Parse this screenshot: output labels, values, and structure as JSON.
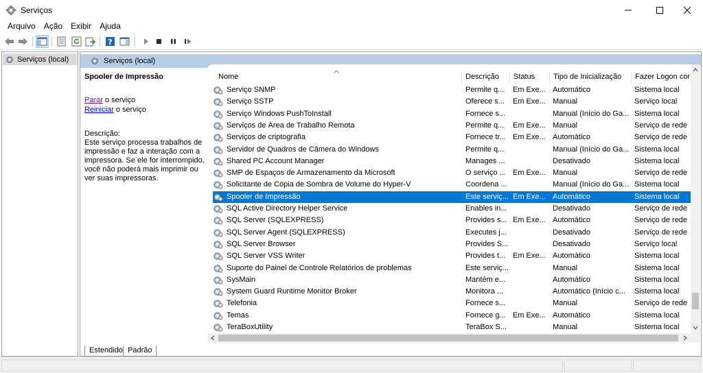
{
  "window": {
    "title": "Serviços"
  },
  "menu": [
    "Arquivo",
    "Ação",
    "Exibir",
    "Ajuda"
  ],
  "tree": {
    "root": "Serviços (local)"
  },
  "panel": {
    "header": "Serviços (local)"
  },
  "detail": {
    "service_name": "Spooler de Impressão",
    "stop_link": "Parar",
    "stop_suffix": " o serviço",
    "restart_link": "Reiniciar",
    "restart_suffix": " o serviço",
    "desc_label": "Descrição:",
    "description": "Este serviço processa trabalhos de impressão e faz a interação com a impressora. Se ele for interrompido, você não poderá mais imprimir ou ver suas impressoras."
  },
  "columns": {
    "name": "Nome",
    "description": "Descrição",
    "status": "Status",
    "startup": "Tipo de Inicialização",
    "logon": "Fazer Logon com"
  },
  "rows": [
    {
      "name": "Serviço SNMP",
      "desc": "Permite q...",
      "status": "Em Exe...",
      "startup": "Automático",
      "logon": "Sistema local"
    },
    {
      "name": "Serviço SSTP",
      "desc": "Oferece s...",
      "status": "Em Exe...",
      "startup": "Manual",
      "logon": "Serviço local"
    },
    {
      "name": "Serviço Windows PushToInstall",
      "desc": "Fornece s...",
      "status": "",
      "startup": "Manual (Início do Ga...",
      "logon": "Sistema local"
    },
    {
      "name": "Serviços de Área de Trabalho Remota",
      "desc": "Permite q...",
      "status": "Em Exe...",
      "startup": "Manual",
      "logon": "Serviço de rede"
    },
    {
      "name": "Serviços de criptografia",
      "desc": "Fornece tr...",
      "status": "Em Exe...",
      "startup": "Automático",
      "logon": "Serviço de rede"
    },
    {
      "name": "Servidor de Quadros de Câmera do Windows",
      "desc": "Permite q...",
      "status": "",
      "startup": "Manual (Início do Ga...",
      "logon": "Sistema local"
    },
    {
      "name": "Shared PC Account Manager",
      "desc": "Manages ...",
      "status": "",
      "startup": "Desativado",
      "logon": "Sistema local"
    },
    {
      "name": "SMP de Espaços de Armazenamento da Microsoft",
      "desc": "O serviço ...",
      "status": "Em Exe...",
      "startup": "Manual",
      "logon": "Serviço de rede"
    },
    {
      "name": "Solicitante de Cópia de Sombra de Volume do Hyper-V",
      "desc": "Coordena ...",
      "status": "",
      "startup": "Manual (Início do Ga...",
      "logon": "Sistema local"
    },
    {
      "name": "Spooler de Impressão",
      "desc": "Este serviç...",
      "status": "Em Exe...",
      "startup": "Automático",
      "logon": "Sistema local",
      "selected": true
    },
    {
      "name": "SQL Active Directory Helper Service",
      "desc": "Enables in...",
      "status": "",
      "startup": "Desativado",
      "logon": "Serviço de rede"
    },
    {
      "name": "SQL Server (SQLEXPRESS)",
      "desc": "Provides s...",
      "status": "Em Exe...",
      "startup": "Automático",
      "logon": "Serviço de rede"
    },
    {
      "name": "SQL Server Agent (SQLEXPRESS)",
      "desc": "Executes j...",
      "status": "",
      "startup": "Desativado",
      "logon": "Serviço de rede"
    },
    {
      "name": "SQL Server Browser",
      "desc": "Provides S...",
      "status": "",
      "startup": "Desativado",
      "logon": "Serviço local"
    },
    {
      "name": "SQL Server VSS Writer",
      "desc": "Provides t...",
      "status": "Em Exe...",
      "startup": "Automático",
      "logon": "Sistema local"
    },
    {
      "name": "Suporte do Painel de Controle Relatórios de problemas",
      "desc": "Este serviç...",
      "status": "",
      "startup": "Manual",
      "logon": "Sistema local"
    },
    {
      "name": "SysMain",
      "desc": "Mantém e...",
      "status": "",
      "startup": "Automático",
      "logon": "Sistema local"
    },
    {
      "name": "System Guard Runtime Monitor Broker",
      "desc": "Monitora ...",
      "status": "",
      "startup": "Automático (Início c...",
      "logon": "Sistema local"
    },
    {
      "name": "Telefonia",
      "desc": "Fornece s...",
      "status": "",
      "startup": "Manual",
      "logon": "Serviço de rede"
    },
    {
      "name": "Temas",
      "desc": "Fornece g...",
      "status": "Em Exe...",
      "startup": "Automático",
      "logon": "Sistema local"
    },
    {
      "name": "TeraBoxUtility",
      "desc": "TeraBox S...",
      "status": "",
      "startup": "Manual",
      "logon": "Sistema local"
    }
  ],
  "tabs": [
    "Estendido",
    "Padrão"
  ],
  "colors": {
    "selection": "#0078d7",
    "panel_header": "#b8cde4",
    "link_visited": "#6b0e9a",
    "link": "#0000d6"
  }
}
